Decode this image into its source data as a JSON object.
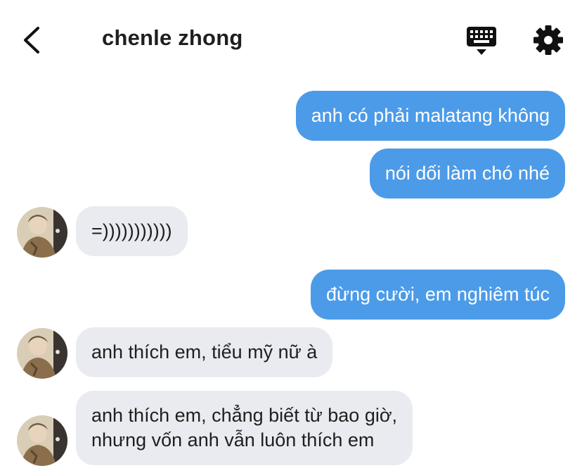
{
  "header": {
    "title": "chenle zhong",
    "back_icon": "chevron-left-icon",
    "keyboard_icon": "keyboard-icon",
    "settings_icon": "gear-icon"
  },
  "colors": {
    "outgoing_bubble": "#4c9be8",
    "incoming_bubble": "#e9ebf0",
    "text_dark": "#1f1f1f"
  },
  "messages": [
    {
      "direction": "out",
      "text": "anh có phải malatang không"
    },
    {
      "direction": "out",
      "text": "nói dối làm chó nhé"
    },
    {
      "direction": "in",
      "text": "=)))))))))))"
    },
    {
      "direction": "out",
      "text": "đừng cười, em nghiêm túc"
    },
    {
      "direction": "in",
      "text": "anh thích em, tiểu mỹ nữ à"
    },
    {
      "direction": "in",
      "lines": [
        "anh thích em, chẳng biết từ bao giờ,",
        "nhưng vốn anh vẫn luôn thích em"
      ]
    }
  ]
}
